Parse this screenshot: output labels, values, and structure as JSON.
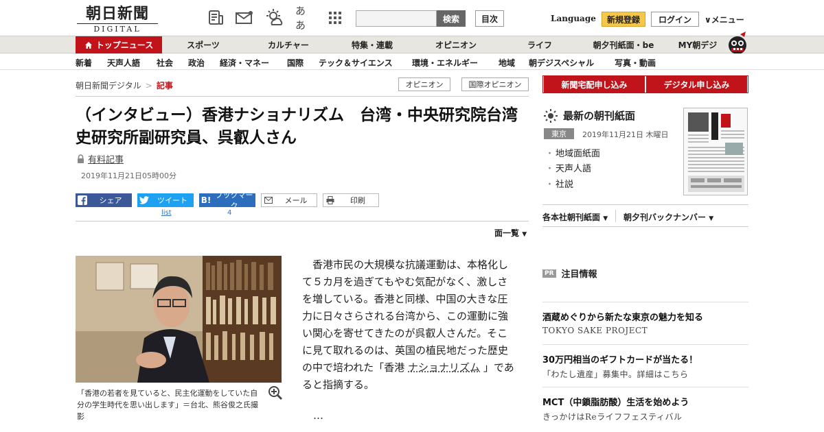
{
  "header": {
    "logo_text": "朝日新聞",
    "logo_sub": "DIGITAL",
    "search_button": "検索",
    "index_button": "目次",
    "language": "Language",
    "signup": "新規登録",
    "login": "ログイン",
    "menu": "∨メニュー",
    "font_toggle": "ああ"
  },
  "main_nav": [
    "トップニュース",
    "スポーツ",
    "カルチャー",
    "特集・連載",
    "オピニオン",
    "ライフ",
    "朝夕刊紙面・be",
    "MY朝デジ"
  ],
  "sub_nav": [
    "新着",
    "天声人語",
    "社会",
    "政治",
    "経済・マネー",
    "国際",
    "テック＆サイエンス",
    "環境・エネルギー",
    "地域",
    "朝デジスペシャル",
    "写真・動画"
  ],
  "breadcrumb": {
    "home": "朝日新聞デジタル",
    "sep": ">",
    "current": "記事"
  },
  "tags": [
    "オピニオン",
    "国際オピニオン"
  ],
  "article": {
    "headline": "（インタビュー）香港ナショナリズム　台湾・中央研究院台湾史研究所副研究員、呉叡人さん",
    "paid_label": "有料記事",
    "datetime": "2019年11月21日05時00分",
    "page_list": "面一覧",
    "caption": "「香港の若者を見ていると、民主化運動をしていた自分の学生時代を思い出します」＝台北、熊谷俊之氏撮影",
    "body_before": "香港市民の大規模な抗議運動は、本格化して５カ月を過ぎてもやむ気配がなく、激しさを増している。香港と同様、中国の大きな圧力に日々さらされる台湾から、この運動に強い関心を寄せてきたのが呉叡人さんだ。そこに見て取れるのは、英国の植民地だった歴史の中で培われた「香港",
    "body_link": "ナショナリズム",
    "body_after": "」であると指摘する。",
    "ellipsis": "…"
  },
  "share": {
    "facebook": "シェア",
    "twitter": "ツイート",
    "twitter_count": "list",
    "hatena": "ブックマーク",
    "hatena_count": "4",
    "mail": "メール",
    "print": "印刷"
  },
  "sidebar": {
    "subscribe_home": "新聞宅配申し込み",
    "subscribe_digital": "デジタル申し込み",
    "paper_title": "最新の朝刊紙面",
    "region": "東京",
    "paper_date": "2019年11月21日 木曜日",
    "links": [
      "地域面紙面",
      "天声人語",
      "社説"
    ],
    "morning_dropdown": "各本社朝刊紙面",
    "back_dropdown": "朝夕刊バックナンバー",
    "pr_badge": "PR",
    "pr_title": "注目情報",
    "pr_items": [
      {
        "title": "酒蔵めぐりから新たな東京の魅力を知る",
        "sub": "TOKYO SAKE PROJECT"
      },
      {
        "title": "30万円相当のギフトカードが当たる！",
        "sub": "「わたし遺産」募集中。詳細はこちら"
      },
      {
        "title": "MCT（中鎖脂肪酸）生活を始めよう",
        "sub": "きっかけはReライフフェスティバル"
      }
    ]
  },
  "colors": {
    "brand_red": "#c0141a",
    "signup_yellow": "#f5c84a",
    "facebook": "#3b5998",
    "twitter": "#1da1f2",
    "hatena": "#2c6ebd"
  },
  "icons": [
    "news-icon",
    "mail-icon",
    "weather-icon",
    "font-size-icon",
    "grid-menu-icon",
    "home-icon",
    "lock-icon",
    "zoom-icon",
    "sun-icon",
    "mascot-icon"
  ]
}
